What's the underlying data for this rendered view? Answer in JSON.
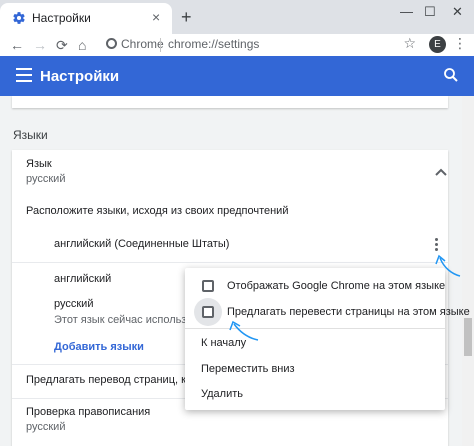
{
  "browser": {
    "tab_title": "Настройки",
    "tab_close": "×",
    "new_tab": "+",
    "window_minimize": "—",
    "window_maximize": "☐",
    "window_close": "✕",
    "omnibox_chip": "Chrome",
    "omnibox_url": "chrome://settings",
    "avatar_letter": "E"
  },
  "header": {
    "title": "Настройки"
  },
  "languages": {
    "section_title": "Языки",
    "language_label": "Язык",
    "language_value": "русский",
    "order_hint": "Расположите языки, исходя из своих предпочтений",
    "items": [
      {
        "name": "английский (Соединенные Штаты)"
      },
      {
        "name": "английский"
      },
      {
        "name": "русский",
        "note": "Этот язык сейчас используетс"
      }
    ],
    "add_languages": "Добавить языки",
    "offer_translate": "Предлагать перевод страниц, которые на из",
    "spellcheck_label": "Проверка правописания",
    "spellcheck_value": "русский"
  },
  "popup_menu": {
    "items": [
      {
        "label": "Отображать Google Chrome на этом языке",
        "checked": false
      },
      {
        "label": "Предлагать перевести страницы на этом языке",
        "checked": false
      },
      {
        "label": "К началу"
      },
      {
        "label": "Переместить вниз"
      },
      {
        "label": "Удалить"
      }
    ]
  },
  "colors": {
    "header_bg": "#3367d6",
    "accent": "#3367d6",
    "annotation": "#2196f3"
  }
}
